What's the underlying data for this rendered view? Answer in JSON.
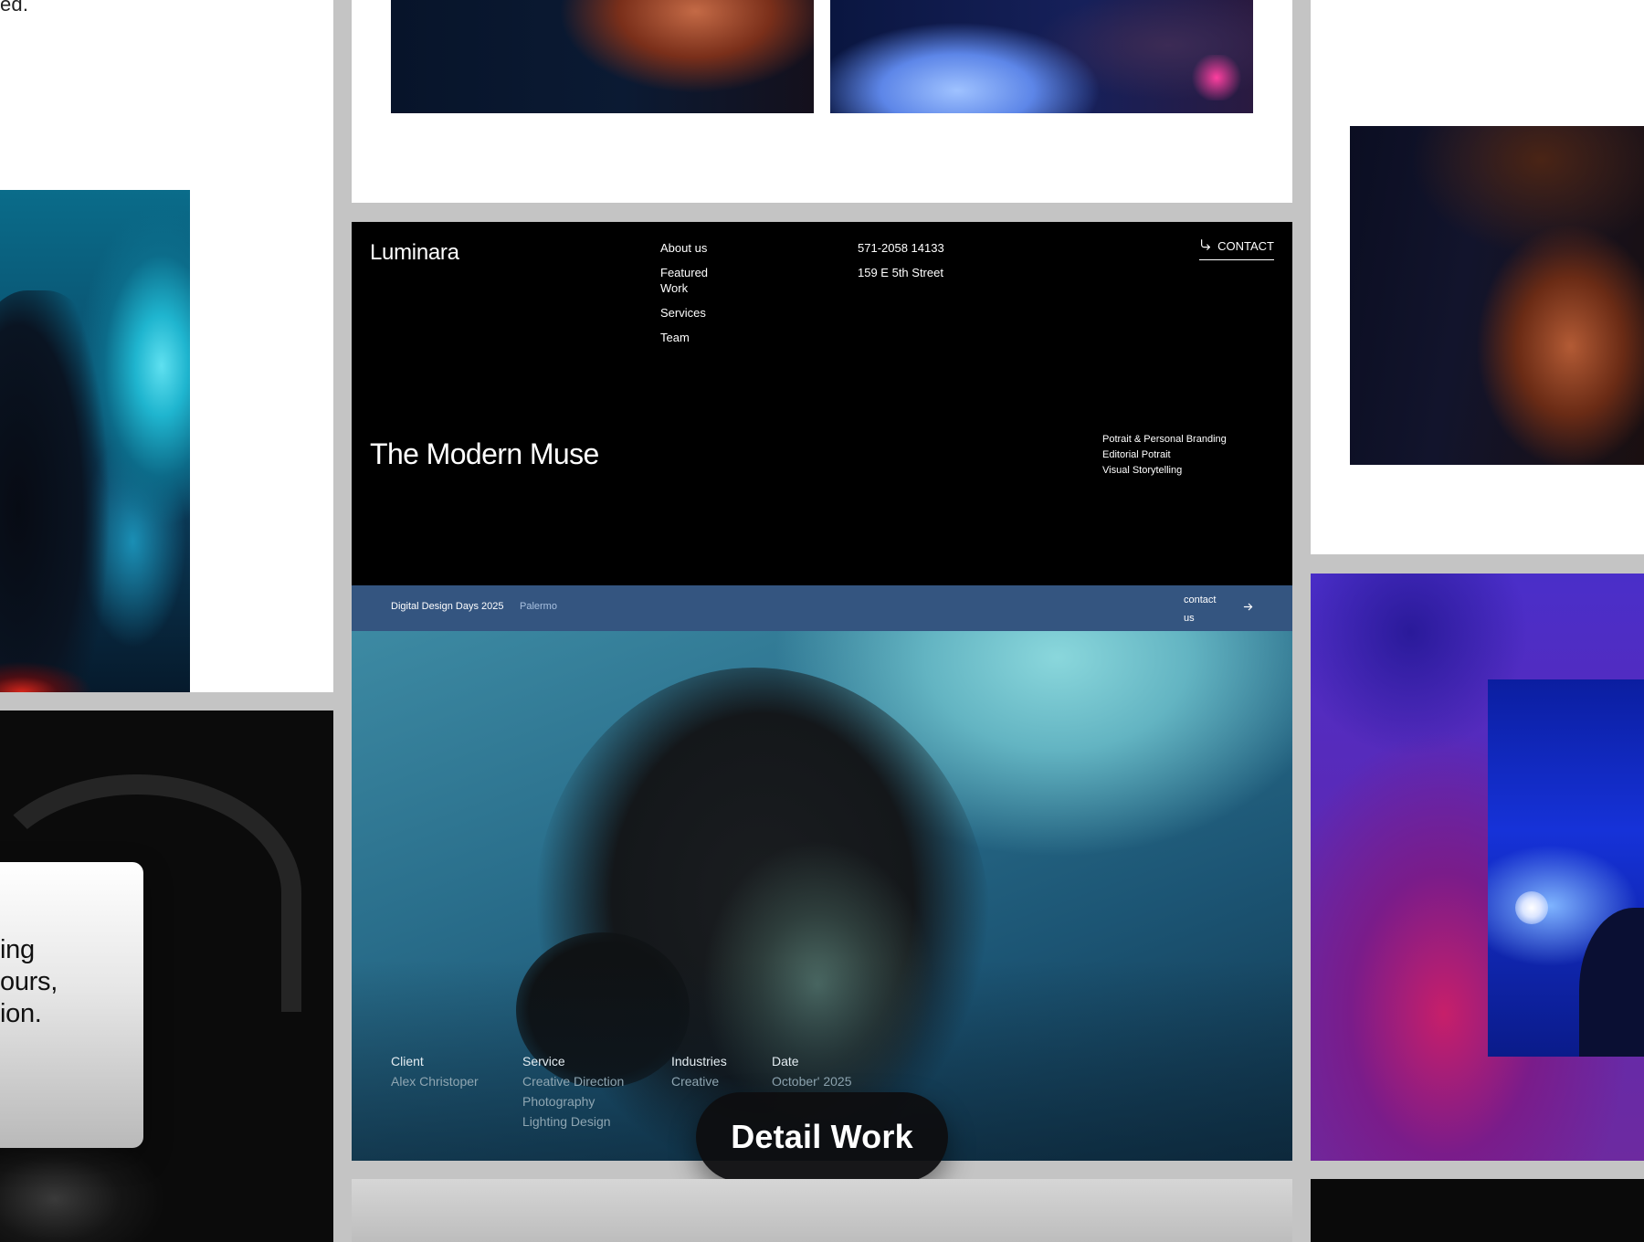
{
  "left_panel": {
    "partial_text_top": "ed.",
    "quote_lines": [
      "ing",
      "ours,",
      "ion."
    ]
  },
  "header": {
    "brand": "Luminara",
    "nav": [
      "About us",
      "Featured Work",
      "Services",
      "Team"
    ],
    "phone": "571-2058 14133",
    "address": "159 E 5th Street",
    "contact_label": "CONTACT"
  },
  "hero": {
    "title": "The Modern Muse",
    "services": [
      "Potrait & Personal Branding",
      "Editorial Potrait",
      "Visual Storytelling"
    ]
  },
  "event_bar": {
    "title": "Digital Design Days 2025",
    "place": "Palermo",
    "contact_label": "contact us"
  },
  "project_meta": {
    "client": {
      "label": "Client",
      "value": "Alex Christoper"
    },
    "service": {
      "label": "Service",
      "values": [
        "Creative Direction",
        "Photography",
        "Lighting Design"
      ]
    },
    "industries": {
      "label": "Industries",
      "value": "Creative"
    },
    "date": {
      "label": "Date",
      "value": "October' 2025"
    }
  },
  "detail_button": {
    "label": "Detail Work"
  },
  "icons": {
    "contact": "corner-down-right-icon",
    "arrow": "arrow-right-icon"
  },
  "colors": {
    "event_bar": "#345580",
    "event_place": "#a9c1e0",
    "header_bg": "#000000",
    "meta_value": "#8fa6b2"
  }
}
